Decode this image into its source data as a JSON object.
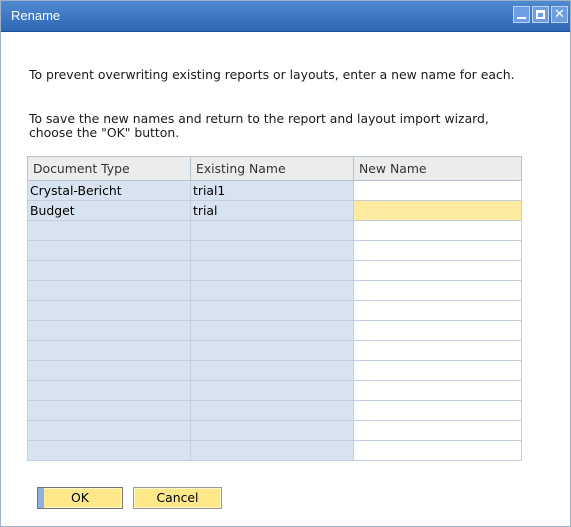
{
  "window": {
    "title": "Rename",
    "controls": [
      "minimize",
      "maximize",
      "close"
    ],
    "close_glyph": "✕"
  },
  "message": {
    "line1": "To prevent overwriting existing reports or layouts, enter a new name for each.",
    "line2": "To save the new names and return to the report and layout import wizard,",
    "line3": "choose the \"OK\" button."
  },
  "table": {
    "columns": [
      "Document Type",
      "Existing Name",
      "New Name"
    ],
    "rows": [
      {
        "document_type": "Crystal-Bericht",
        "existing_name": "trial1",
        "new_name": ""
      },
      {
        "document_type": "Budget",
        "existing_name": "trial",
        "new_name": ""
      },
      {
        "document_type": "",
        "existing_name": "",
        "new_name": ""
      },
      {
        "document_type": "",
        "existing_name": "",
        "new_name": ""
      },
      {
        "document_type": "",
        "existing_name": "",
        "new_name": ""
      },
      {
        "document_type": "",
        "existing_name": "",
        "new_name": ""
      },
      {
        "document_type": "",
        "existing_name": "",
        "new_name": ""
      },
      {
        "document_type": "",
        "existing_name": "",
        "new_name": ""
      },
      {
        "document_type": "",
        "existing_name": "",
        "new_name": ""
      },
      {
        "document_type": "",
        "existing_name": "",
        "new_name": ""
      },
      {
        "document_type": "",
        "existing_name": "",
        "new_name": ""
      },
      {
        "document_type": "",
        "existing_name": "",
        "new_name": ""
      },
      {
        "document_type": "",
        "existing_name": "",
        "new_name": ""
      },
      {
        "document_type": "",
        "existing_name": "",
        "new_name": ""
      }
    ]
  },
  "buttons": {
    "ok": "OK",
    "cancel": "Cancel"
  },
  "colors": {
    "titlebar": "#3a75c4",
    "readonly_cell": "#d8e3f1",
    "active_cell": "#fdeb9f",
    "button_fill": "#ffe88a"
  }
}
